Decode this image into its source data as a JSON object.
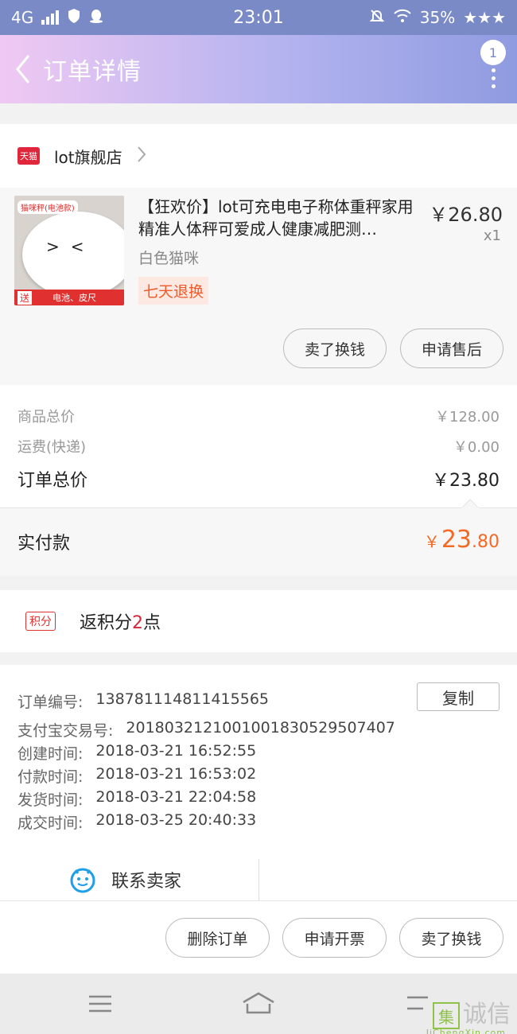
{
  "status_bar": {
    "network": "4G",
    "time": "23:01",
    "battery": "35%"
  },
  "nav": {
    "title": "订单详情",
    "badge_count": "1"
  },
  "shop": {
    "badge": "天猫",
    "name": "lot旗舰店"
  },
  "item": {
    "title": "【狂欢价】lot可充电电子称体重秤家用精准人体秤可爱成人健康减肥测…",
    "price": "￥26.80",
    "qty": "x1",
    "spec": "白色猫咪",
    "return_policy": "七天退换",
    "thumb_tag": "猫咪秤(电池款)",
    "thumb_send": "送",
    "thumb_gift": "电池、皮尺",
    "buttons": {
      "sell": "卖了换钱",
      "after_sale": "申请售后"
    }
  },
  "pricing": {
    "goods_total_label": "商品总价",
    "goods_total": "￥128.00",
    "shipping_label": "运费(快递)",
    "shipping": "￥0.00",
    "order_total_label": "订单总价",
    "order_total": "￥23.80",
    "paid_label": "实付款",
    "paid_symbol": "￥",
    "paid_int": "23",
    "paid_dec": ".80"
  },
  "points": {
    "badge": "积分",
    "prefix": "返积分",
    "count": "2",
    "suffix": "点"
  },
  "order_info": {
    "order_no_label": "订单编号:",
    "order_no": "1387811148114155 65",
    "copy_label": "复制",
    "alipay_label": "支付宝交易号:",
    "alipay_no": "2018032121001001830529507407",
    "created_label": "创建时间:",
    "created": "2018-03-21 16:52:55",
    "paid_label": "付款时间:",
    "paid": "2018-03-21 16:53:02",
    "shipped_label": "发货时间:",
    "shipped": "2018-03-21 22:04:58",
    "closed_label": "成交时间:",
    "closed": "2018-03-25 20:40:33",
    "contact_label": "联系卖家"
  },
  "actions": {
    "delete": "删除订单",
    "invoice": "申请开票",
    "sell": "卖了换钱"
  },
  "watermark": {
    "mark": "集",
    "text": "诚信",
    "sub": "JiChengXin.com"
  },
  "colors": {
    "accent_orange": "#f26a24",
    "tmall_red": "#e0263b",
    "header_gradient_start": "#f0c9f3",
    "header_gradient_end": "#8f9be0"
  }
}
